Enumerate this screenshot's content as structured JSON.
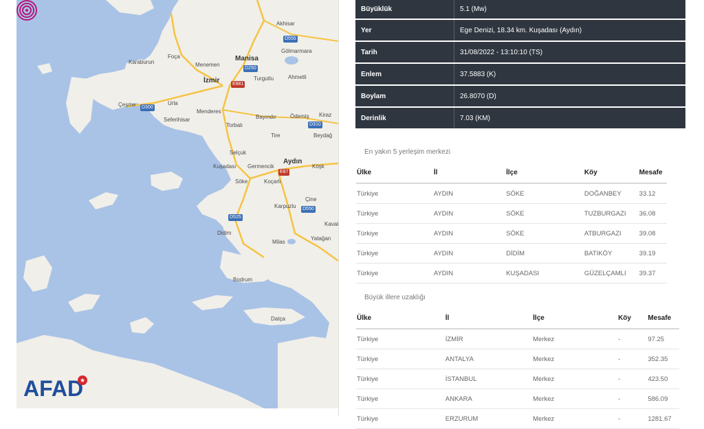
{
  "map": {
    "logo": "AFAD",
    "labels": [
      {
        "name": "Akhisar",
        "text": "Akhisar"
      },
      {
        "name": "Gölmarmara",
        "text": "Gölmarmara"
      },
      {
        "name": "Manisa",
        "text": "Manisa"
      },
      {
        "name": "Foça",
        "text": "Foça"
      },
      {
        "name": "Karaburun",
        "text": "Karaburun"
      },
      {
        "name": "Menemen",
        "text": "Menemen"
      },
      {
        "name": "Turgutlu",
        "text": "Turgutlu"
      },
      {
        "name": "İzmir",
        "text": "İzmir"
      },
      {
        "name": "Urla",
        "text": "Urla"
      },
      {
        "name": "Çeşme",
        "text": "Çeşme"
      },
      {
        "name": "Menderes",
        "text": "Menderes"
      },
      {
        "name": "Ahmetli",
        "text": "Ahmetli"
      },
      {
        "name": "Ödemiş",
        "text": "Ödemiş"
      },
      {
        "name": "Kiraz",
        "text": "Kiraz"
      },
      {
        "name": "Seferihisar",
        "text": "Seferihisar"
      },
      {
        "name": "Bayındır",
        "text": "Bayındır"
      },
      {
        "name": "Torbalı",
        "text": "Torbalı"
      },
      {
        "name": "Tire",
        "text": "Tire"
      },
      {
        "name": "Beydağ",
        "text": "Beydağ"
      },
      {
        "name": "Selçuk",
        "text": "Selçuk"
      },
      {
        "name": "Kuşadası",
        "text": "Kuşadası"
      },
      {
        "name": "Germencik",
        "text": "Germencik"
      },
      {
        "name": "Aydın",
        "text": "Aydın"
      },
      {
        "name": "Köşk",
        "text": "Köşk"
      },
      {
        "name": "Söke",
        "text": "Söke"
      },
      {
        "name": "Koçarlı",
        "text": "Koçarlı"
      },
      {
        "name": "Karpuzlu",
        "text": "Karpuzlu"
      },
      {
        "name": "Çine",
        "text": "Çine"
      },
      {
        "name": "Kavak",
        "text": "Kavak"
      },
      {
        "name": "Didim",
        "text": "Didim"
      },
      {
        "name": "Milas",
        "text": "Milas"
      },
      {
        "name": "Yatağan",
        "text": "Yatağan"
      },
      {
        "name": "Bodrum",
        "text": "Bodrum"
      },
      {
        "name": "Datça",
        "text": "Datça"
      }
    ],
    "roads": [
      {
        "name": "D555",
        "text": "D555"
      },
      {
        "name": "D250",
        "text": "D250"
      },
      {
        "name": "E881",
        "text": "E881"
      },
      {
        "name": "D300",
        "text": "D300"
      },
      {
        "name": "D310",
        "text": "D310"
      },
      {
        "name": "E87",
        "text": "E87"
      },
      {
        "name": "D550",
        "text": "D550"
      },
      {
        "name": "D525",
        "text": "D525"
      }
    ]
  },
  "info": [
    {
      "key": "Büyüklük",
      "value": "5.1 (Mw)"
    },
    {
      "key": "Yer",
      "value": "Ege Denizi, 18.34 km. Kuşadası (Aydın)"
    },
    {
      "key": "Tarih",
      "value": "31/08/2022 - 13:10:10 (TS)"
    },
    {
      "key": "Enlem",
      "value": "37.5883 (K)"
    },
    {
      "key": "Boylam",
      "value": "26.8070 (D)"
    },
    {
      "key": "Derinlik",
      "value": "7.03 (KM)"
    }
  ],
  "nearest": {
    "title": "En yakın 5 yerleşim merkezi",
    "headers": [
      "Ülke",
      "İl",
      "İlçe",
      "Köy",
      "Mesafe"
    ],
    "rows": [
      [
        "Türkiye",
        "AYDIN",
        "SÖKE",
        "DOĞANBEY",
        "33.12"
      ],
      [
        "Türkiye",
        "AYDIN",
        "SÖKE",
        "TUZBURGAZI",
        "36.08"
      ],
      [
        "Türkiye",
        "AYDIN",
        "SÖKE",
        "ATBURGAZI",
        "39.08"
      ],
      [
        "Türkiye",
        "AYDIN",
        "DİDİM",
        "BATIKÖY",
        "39.19"
      ],
      [
        "Türkiye",
        "AYDIN",
        "KUŞADASI",
        "GÜZELÇAMLI",
        "39.37"
      ]
    ]
  },
  "cities": {
    "title": "Büyük illere uzaklığı",
    "headers": [
      "Ülke",
      "İl",
      "İlçe",
      "Köy",
      "Mesafe"
    ],
    "rows": [
      [
        "Türkiye",
        "İZMİR",
        "Merkez",
        "-",
        "97.25"
      ],
      [
        "Türkiye",
        "ANTALYA",
        "Merkez",
        "-",
        "352.35"
      ],
      [
        "Türkiye",
        "İSTANBUL",
        "Merkez",
        "-",
        "423.50"
      ],
      [
        "Türkiye",
        "ANKARA",
        "Merkez",
        "-",
        "586.09"
      ],
      [
        "Türkiye",
        "ERZURUM",
        "Merkez",
        "-",
        "1281.67"
      ]
    ]
  }
}
